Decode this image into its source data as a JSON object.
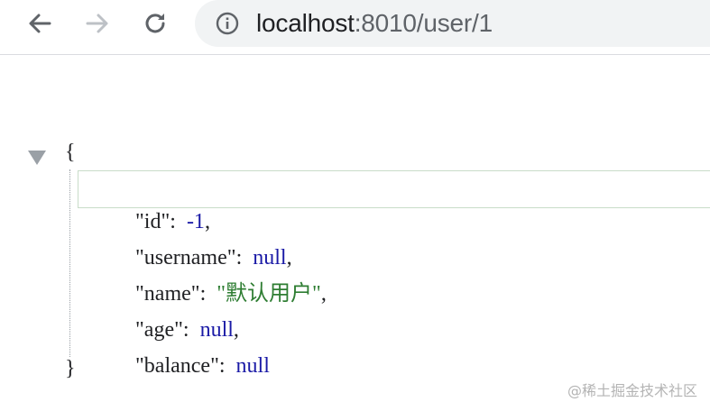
{
  "browser": {
    "url_host": "localhost",
    "url_rest": ":8010/user/1",
    "icons": {
      "back": "back-arrow-icon",
      "forward": "forward-arrow-icon",
      "reload": "reload-icon",
      "info": "info-icon"
    }
  },
  "json_view": {
    "open_brace": "{",
    "close_brace": "}",
    "rows": [
      {
        "key": "\"id\"",
        "colon": ":  ",
        "value": "-1",
        "type": "number",
        "comma": ","
      },
      {
        "key": "\"username\"",
        "colon": ":  ",
        "value": "null",
        "type": "null",
        "comma": ","
      },
      {
        "key": "\"name\"",
        "colon": ":  ",
        "value": "\"默认用户\"",
        "type": "string",
        "comma": ","
      },
      {
        "key": "\"age\"",
        "colon": ":  ",
        "value": "null",
        "type": "null",
        "comma": ","
      },
      {
        "key": "\"balance\"",
        "colon": ":  ",
        "value": "null",
        "type": "null",
        "comma": ""
      }
    ]
  },
  "watermark": "@稀土掘金技术社区",
  "colors": {
    "number": "#1a1aa6",
    "string": "#2e7d32",
    "null": "#1a1aa6",
    "highlight_border": "#c8dcc8"
  }
}
